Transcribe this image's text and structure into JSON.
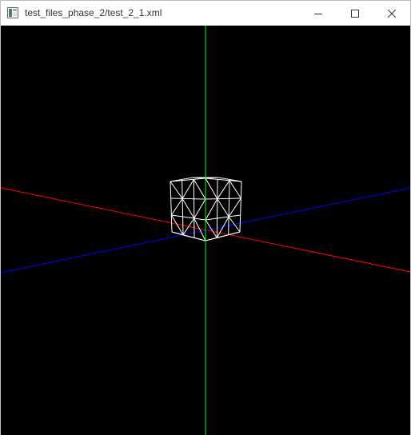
{
  "window": {
    "title": "test_files_phase_2/test_2_1.xml",
    "icon": "app-window-icon",
    "controls": {
      "minimize_icon": "minimize-icon",
      "maximize_icon": "maximize-icon",
      "close_icon": "close-icon"
    }
  },
  "scene": {
    "background_color": "#000000",
    "axes": [
      {
        "name": "x",
        "color": "#ff0000"
      },
      {
        "name": "y",
        "color": "#00ff00"
      },
      {
        "name": "z",
        "color": "#0000ff"
      }
    ],
    "model": {
      "shape": "box",
      "render_mode": "wireframe",
      "color": "#ffffff"
    }
  }
}
